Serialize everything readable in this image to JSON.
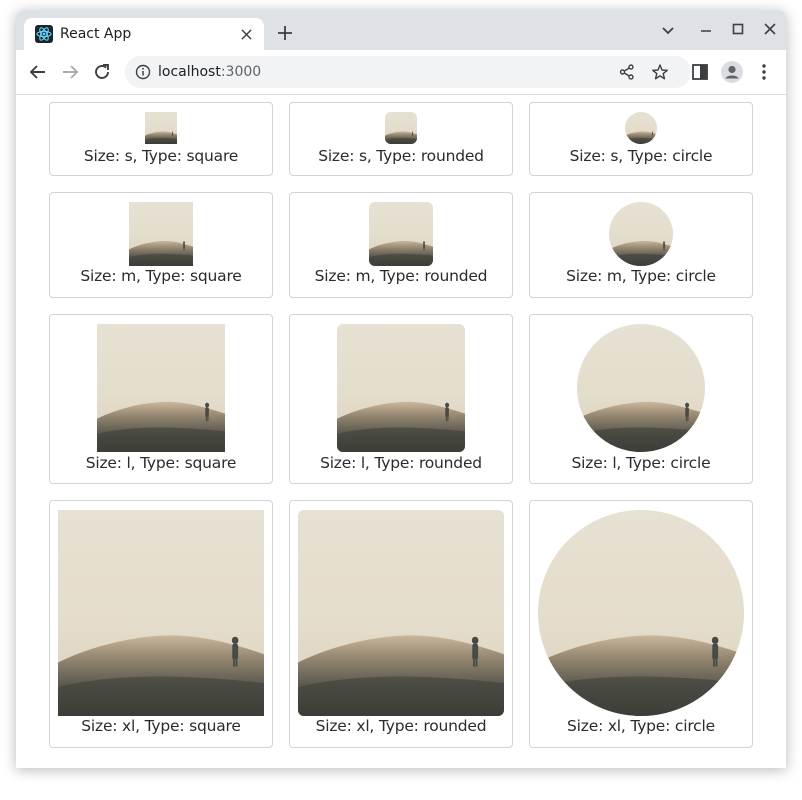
{
  "browser": {
    "tab_title": "React App",
    "url_host": "localhost",
    "url_port": ":3000",
    "icons": {
      "favicon": "react-logo-icon",
      "tab_close": "close-icon",
      "new_tab": "plus-icon",
      "tab_search": "chevron-down-icon",
      "minimize": "minimize-icon",
      "maximize": "maximize-icon",
      "close": "close-icon",
      "back": "arrow-left-icon",
      "forward": "arrow-right-icon",
      "reload": "reload-icon",
      "site_info": "info-icon",
      "share": "share-icon",
      "bookmark": "star-icon",
      "side_panel": "side-panel-icon",
      "profile": "profile-icon",
      "menu": "kebab-menu-icon"
    },
    "colors": {
      "tabbar": "#dee1e6",
      "omnibox": "#f1f3f4"
    }
  },
  "avatars": [
    {
      "caption": "Size: s, Type: square"
    },
    {
      "caption": "Size: s, Type: rounded"
    },
    {
      "caption": "Size: s, Type: circle"
    },
    {
      "caption": "Size: m, Type: square"
    },
    {
      "caption": "Size: m, Type: rounded"
    },
    {
      "caption": "Size: m, Type: circle"
    },
    {
      "caption": "Size: l, Type: square"
    },
    {
      "caption": "Size: l, Type: rounded"
    },
    {
      "caption": "Size: l, Type: circle"
    },
    {
      "caption": "Size: xl, Type: square"
    },
    {
      "caption": "Size: xl, Type: rounded"
    },
    {
      "caption": "Size: xl, Type: circle"
    }
  ]
}
